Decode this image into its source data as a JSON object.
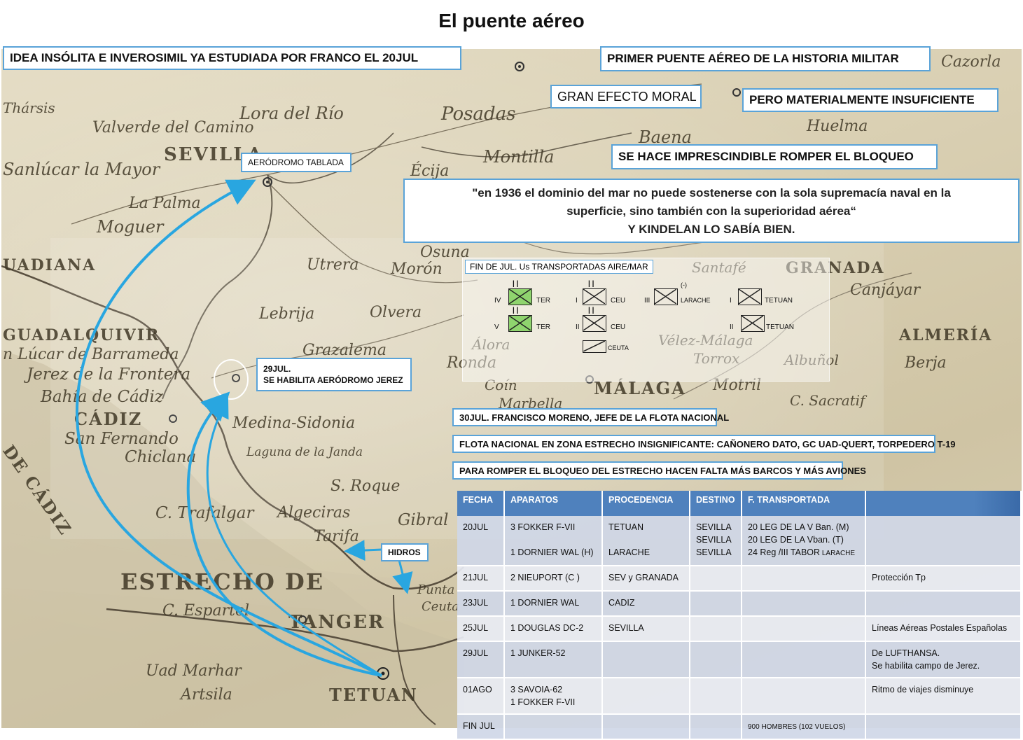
{
  "title": "El puente aéreo",
  "callouts": {
    "idea": "IDEA INSÓLITA E INVEROSIMIL YA ESTUDIADA  POR FRANCO EL 20JUL",
    "primer": "PRIMER PUENTE AÉREO DE LA HISTORIA MILITAR",
    "efecto": "GRAN EFECTO MORAL",
    "insuficiente": "PERO MATERIALMENTE INSUFICIENTE",
    "bloqueo": "SE HACE IMPRESCINDIBLE ROMPER EL BLOQUEO",
    "quote_line1": "\"en 1936 el dominio del mar no puede sostenerse con la sola supremacía naval en la",
    "quote_line2": "superficie, sino también con la superioridad aérea“",
    "quote_line3": "Y KINDELAN LO SABÍA BIEN.",
    "tablada": "AERÓDROMO TABLADA",
    "jerez_line1": "29JUL.",
    "jerez_line2": "SE HABILITA AERÓDROMO JEREZ",
    "hidros": "HIDROS",
    "moreno": "30JUL. FRANCISCO MORENO, JEFE DE LA FLOTA NACIONAL",
    "flota": "FLOTA NACIONAL EN ZONA ESTRECHO INSIGNIFICANTE: CAÑONERO DATO, GC UAD-QUERT, TORPEDERO T-19",
    "romper": "PARA ROMPER EL BLOQUEO DEL ESTRECHO HACEN FALTA MÁS BARCOS Y MÁS AVIONES"
  },
  "units_panel": {
    "title": "FIN DE JUL. Us TRANSPORTADAS AIRE/MAR",
    "units": [
      {
        "rank": "IV",
        "type": "green",
        "label": "TER"
      },
      {
        "rank": "V",
        "type": "green",
        "label": "TER"
      },
      {
        "rank": "I",
        "type": "infantry",
        "label": "CEU"
      },
      {
        "rank": "II",
        "type": "infantry",
        "label": "CEU"
      },
      {
        "rank": "",
        "type": "slash",
        "label": "CEUTA"
      },
      {
        "rank": "III",
        "type": "infantry",
        "label": "LARACHE",
        "reduced": "(-)"
      },
      {
        "rank": "I",
        "type": "infantry",
        "label": "TETUAN"
      },
      {
        "rank": "II",
        "type": "infantry",
        "label": "TETUAN"
      }
    ]
  },
  "map_labels": {
    "tharsis": "Thársis",
    "valverde": "Valverde del Camino",
    "lora": "Lora del Río",
    "posadas": "Posadas",
    "sevilla": "SEVILLA",
    "sanlucar_mayor": "Sanlúcar la Mayor",
    "lapalma": "La Palma",
    "moguer": "Moguer",
    "uadiana": "UADIANA",
    "guadalquivir": "GUADALQUIVIR",
    "sanlucar": "n Lúcar de Barrameda",
    "jerez": "Jerez de la Frontera",
    "bahia": "Bahía de Cádiz",
    "cadiz": "CÁDIZ",
    "sanfernando": "San Fernando",
    "chiclana": "Chiclana",
    "medina": "Medina-Sidonia",
    "laguna": "Laguna de la Janda",
    "trafalgar": "C. Trafalgar",
    "estrecho": "ESTRECHO DE",
    "esparte": "C. Espartel",
    "tanger": "TANGER",
    "tetuan": "TETUAN",
    "uad_marhar": "Uad Marhar",
    "artsila": "Artsila",
    "tarifa": "Tarifa",
    "algeciras": "Algeciras",
    "sroque": "S. Roque",
    "gibral": "Gibral",
    "ronda": "Ronda",
    "grazalema": "Grazalema",
    "lebrija": "Lebrija",
    "utrera": "Utrera",
    "moron": "Morón",
    "osuna": "Osuna",
    "ecija": "Écija",
    "montilla": "Montilla",
    "baena": "Baena",
    "granada": "GRANADA",
    "malaga": "MÁLAGA",
    "motril": "Motril",
    "almeria": "ALMERÍA",
    "berja": "Berja",
    "sacratif": "C. Sacratif",
    "canjayar": "Canjáyar",
    "velez": "Vélez-Málaga",
    "torrox": "Torrox",
    "albunol": "Albuñol",
    "santafe": "Santafé",
    "coin": "Coín",
    "marbella": "Marbella",
    "alora": "Álora",
    "olvera": "Olvera",
    "jaen": "Huelma",
    "lazorla": "Cazorla",
    "cadiz_gulf": "DE CÁDIZ",
    "ceuta": "Ceuta",
    "punta": "Punta"
  },
  "table": {
    "headers": [
      "FECHA",
      "APARATOS",
      "PROCEDENCIA",
      "DESTINO",
      "F. TRANSPORTADA",
      ""
    ],
    "rows": [
      {
        "fecha": "20JUL",
        "aparatos": [
          "3 FOKKER F-VII",
          "",
          "1 DORNIER WAL (H)"
        ],
        "procedencia": [
          "TETUAN",
          "",
          "LARACHE"
        ],
        "destino": [
          "SEVILLA",
          "SEVILLA",
          "SEVILLA"
        ],
        "fuerza": [
          "20 LEG DE LA V Ban. (M)",
          "20 LEG DE LA Vban. (T)",
          "24 Reg /III TABOR"
        ],
        "fuerza_small": "LARACHE",
        "notas": []
      },
      {
        "fecha": "21JUL",
        "aparatos": [
          "2 NIEUPORT (C )"
        ],
        "procedencia": [
          "SEV y GRANADA"
        ],
        "destino": [],
        "fuerza": [],
        "notas": [
          "Protección Tp"
        ]
      },
      {
        "fecha": "23JUL",
        "aparatos": [
          "1 DORNIER WAL"
        ],
        "procedencia": [
          "CADIZ"
        ],
        "destino": [],
        "fuerza": [],
        "notas": []
      },
      {
        "fecha": "25JUL",
        "aparatos": [
          "1 DOUGLAS DC-2"
        ],
        "procedencia": [
          "SEVILLA"
        ],
        "destino": [],
        "fuerza": [],
        "notas": [
          "Líneas Aéreas Postales Españolas"
        ]
      },
      {
        "fecha": "29JUL",
        "aparatos": [
          "1 JUNKER-52"
        ],
        "procedencia": [],
        "destino": [],
        "fuerza": [],
        "notas": [
          "De LUFTHANSA.",
          "Se habilita campo de Jerez."
        ]
      },
      {
        "fecha": "01AGO",
        "aparatos": [
          "3 SAVOIA-62",
          "1 FOKKER F-VII"
        ],
        "procedencia": [],
        "destino": [],
        "fuerza": [],
        "notas": [
          "Ritmo de viajes disminuye"
        ]
      },
      {
        "fecha": "FIN JUL",
        "aparatos": [],
        "procedencia": [],
        "destino": [],
        "fuerza_small_only": "900 HOMBRES (102 VUELOS)",
        "fuerza": [],
        "notas": []
      }
    ]
  },
  "colors": {
    "arrow": "#29a6e0",
    "header": "#4f81bd",
    "box_border": "#5aa3d8",
    "unit_green": "#8fd46e"
  }
}
